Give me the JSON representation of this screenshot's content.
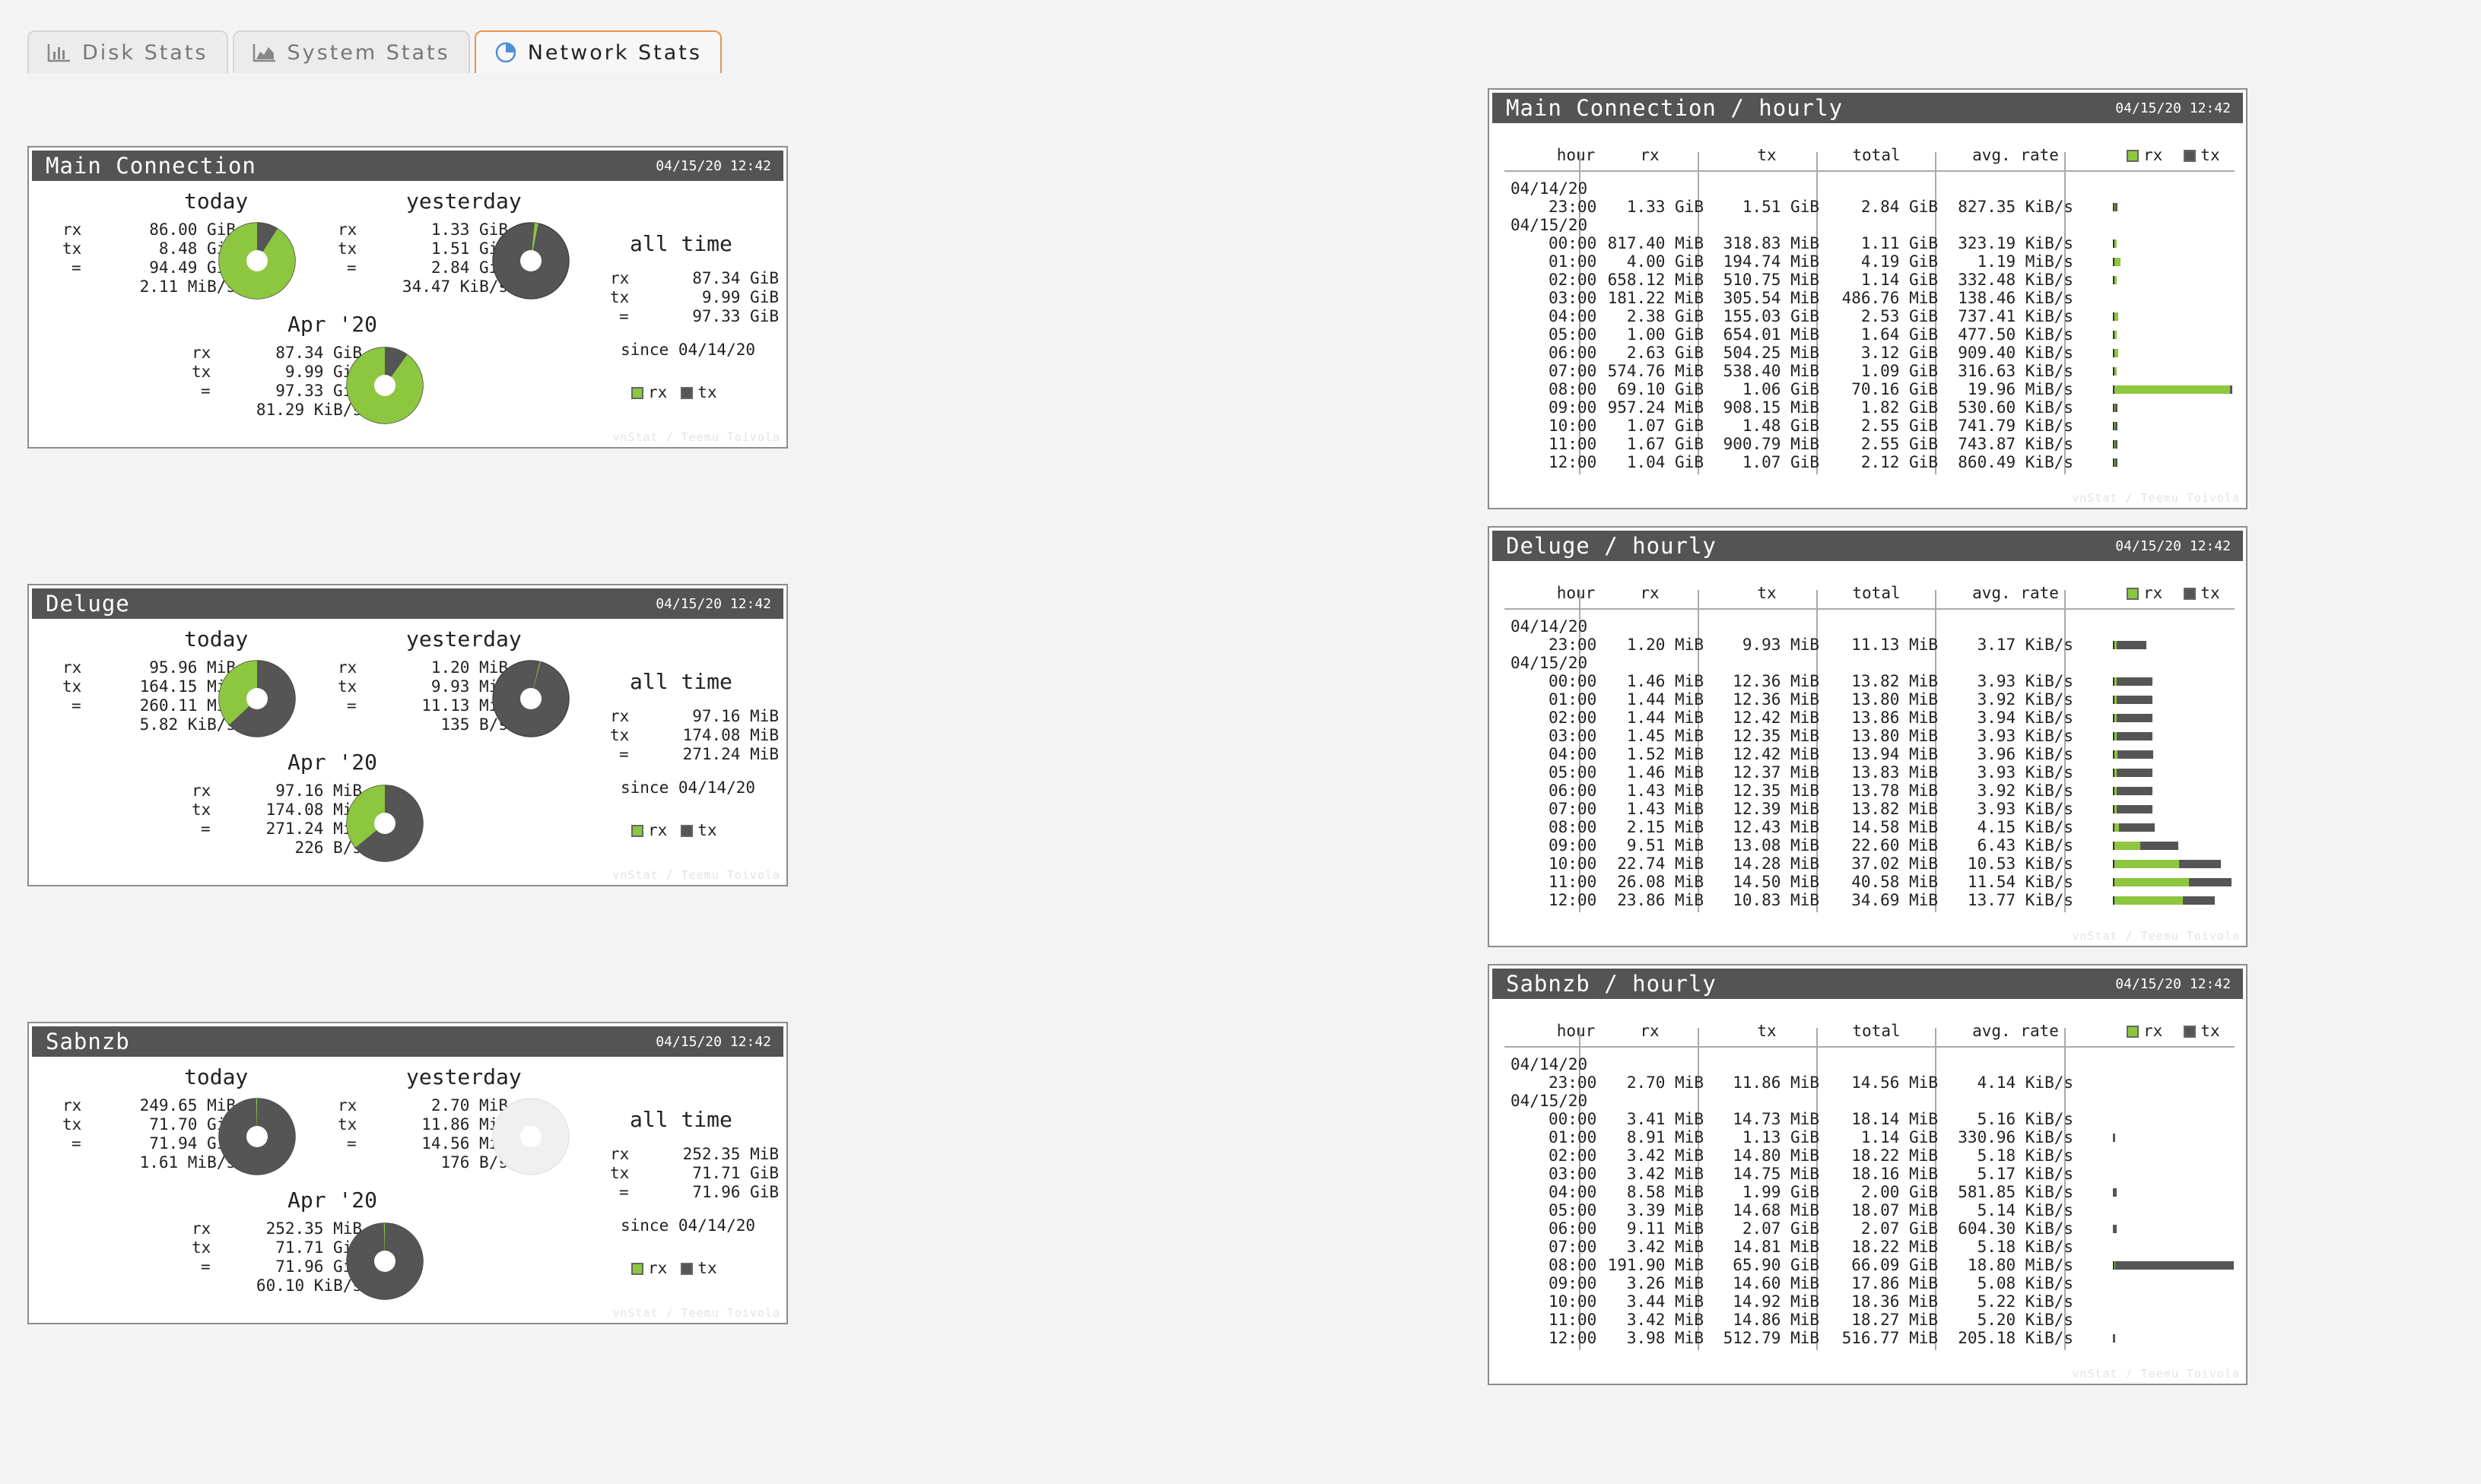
{
  "tabs": [
    {
      "label": "Disk Stats",
      "icon": "bar-chart-icon",
      "active": false
    },
    {
      "label": "System Stats",
      "icon": "area-chart-icon",
      "active": false
    },
    {
      "label": "Network Stats",
      "icon": "pie-chart-icon",
      "active": true
    }
  ],
  "colors": {
    "rx": "#8dc63f",
    "tx": "#555555",
    "accent": "#e8934f",
    "header": "#545454"
  },
  "summaries": [
    {
      "title": "Main Connection",
      "date": "04/15/20 12:42",
      "today": {
        "label": "today",
        "rx": "86.00 GiB",
        "tx": "8.48 GiB",
        "total": "94.49 GiB",
        "rate": "2.11 MiB/s",
        "rx_share": 0.91
      },
      "yesterday": {
        "label": "yesterday",
        "rx": "1.33 GiB",
        "tx": "1.51 GiB",
        "total": "2.84 GiB",
        "rate": "34.47 KiB/s",
        "rx_share": 0.015,
        "tx_share": 0.016
      },
      "month": {
        "label": "Apr '20",
        "rx": "87.34 GiB",
        "tx": "9.99 GiB",
        "total": "97.33 GiB",
        "rate": "81.29 KiB/s",
        "rx_share": 0.9
      },
      "alltime": {
        "label": "all time",
        "rx": "87.34 GiB",
        "tx": "9.99 GiB",
        "total": "97.33 GiB",
        "since": "since 04/14/20"
      }
    },
    {
      "title": "Deluge",
      "date": "04/15/20 12:42",
      "today": {
        "label": "today",
        "rx": "95.96 MiB",
        "tx": "164.15 MiB",
        "total": "260.11 MiB",
        "rate": "5.82 KiB/s",
        "rx_share": 0.37
      },
      "yesterday": {
        "label": "yesterday",
        "rx": "1.20 MiB",
        "tx": "9.93 MiB",
        "total": "11.13 MiB",
        "rate": "135 B/s",
        "rx_share": 0.004,
        "tx_share": 0.037
      },
      "month": {
        "label": "Apr '20",
        "rx": "97.16 MiB",
        "tx": "174.08 MiB",
        "total": "271.24 MiB",
        "rate": "226 B/s",
        "rx_share": 0.36
      },
      "alltime": {
        "label": "all time",
        "rx": "97.16 MiB",
        "tx": "174.08 MiB",
        "total": "271.24 MiB",
        "since": "since 04/14/20"
      }
    },
    {
      "title": "Sabnzb",
      "date": "04/15/20 12:42",
      "today": {
        "label": "today",
        "rx": "249.65 MiB",
        "tx": "71.70 GiB",
        "total": "71.94 GiB",
        "rate": "1.61 MiB/s",
        "rx_share": 0.004
      },
      "yesterday": {
        "label": "yesterday",
        "rx": "2.70 MiB",
        "tx": "11.86 MiB",
        "total": "14.56 MiB",
        "rate": "176 B/s",
        "rx_share": 0.0,
        "tx_share": 0.0
      },
      "month": {
        "label": "Apr '20",
        "rx": "252.35 MiB",
        "tx": "71.71 GiB",
        "total": "71.96 GiB",
        "rate": "60.10 KiB/s",
        "rx_share": 0.004
      },
      "alltime": {
        "label": "all time",
        "rx": "252.35 MiB",
        "tx": "71.71 GiB",
        "total": "71.96 GiB",
        "since": "since 04/14/20"
      }
    }
  ],
  "legend": {
    "rx": "rx",
    "tx": "tx"
  },
  "credit": "vnStat / Teemu Toivola",
  "columns": {
    "hour": "hour",
    "rx": "rx",
    "tx": "tx",
    "total": "total",
    "rate": "avg. rate"
  },
  "row_labels": {
    "rx": "rx",
    "tx": "tx",
    "total": "="
  },
  "hourly": [
    {
      "title": "Main Connection / hourly",
      "date": "04/15/20 12:42",
      "date_labels": [
        "04/14/20",
        "04/15/20"
      ],
      "rows": [
        [
          "23:00",
          "1.33 GiB",
          "1.51 GiB",
          "2.84 GiB",
          "827.35 KiB/s",
          0.008,
          0.008
        ],
        [
          "00:00",
          "817.40 MiB",
          "318.83 MiB",
          "1.11 GiB",
          "323.19 KiB/s",
          0.004,
          0.001
        ],
        [
          "01:00",
          "4.00 GiB",
          "194.74 MiB",
          "4.19 GiB",
          "1.19 MiB/s",
          0.05,
          0.002
        ],
        [
          "02:00",
          "658.12 MiB",
          "510.75 MiB",
          "1.14 GiB",
          "332.48 KiB/s",
          0.0035,
          0.003
        ],
        [
          "03:00",
          "181.22 MiB",
          "305.54 MiB",
          "486.76 MiB",
          "138.46 KiB/s",
          0.001,
          0.002
        ],
        [
          "04:00",
          "2.38 GiB",
          "155.03 GiB",
          "2.53 GiB",
          "737.41 KiB/s",
          0.03,
          0.002
        ],
        [
          "05:00",
          "1.00 GiB",
          "654.01 MiB",
          "1.64 GiB",
          "477.50 KiB/s",
          0.012,
          0.003
        ],
        [
          "06:00",
          "2.63 GiB",
          "504.25 MiB",
          "3.12 GiB",
          "909.40 KiB/s",
          0.03,
          0.003
        ],
        [
          "07:00",
          "574.76 MiB",
          "538.40 MiB",
          "1.09 GiB",
          "316.63 KiB/s",
          0.006,
          0.003
        ],
        [
          "08:00",
          "69.10 GiB",
          "1.06 GiB",
          "70.16 GiB",
          "19.96 MiB/s",
          0.985,
          0.015
        ],
        [
          "09:00",
          "957.24 MiB",
          "908.15 MiB",
          "1.82 GiB",
          "530.60 KiB/s",
          0.012,
          0.01
        ],
        [
          "10:00",
          "1.07 GiB",
          "1.48 GiB",
          "2.55 GiB",
          "741.79 KiB/s",
          0.013,
          0.017
        ],
        [
          "11:00",
          "1.67 GiB",
          "900.79 MiB",
          "2.55 GiB",
          "743.87 KiB/s",
          0.02,
          0.01
        ],
        [
          "12:00",
          "1.04 GiB",
          "1.07 GiB",
          "2.12 GiB",
          "860.49 KiB/s",
          0.013,
          0.013
        ]
      ]
    },
    {
      "title": "Deluge / hourly",
      "date": "04/15/20 12:42",
      "date_labels": [
        "04/14/20",
        "04/15/20"
      ],
      "rows": [
        [
          "23:00",
          "1.20 MiB",
          "9.93 MiB",
          "11.13 MiB",
          "3.17 KiB/s",
          0.03,
          0.25
        ],
        [
          "00:00",
          "1.46 MiB",
          "12.36 MiB",
          "13.82 MiB",
          "3.93 KiB/s",
          0.035,
          0.3
        ],
        [
          "01:00",
          "1.44 MiB",
          "12.36 MiB",
          "13.80 MiB",
          "3.92 KiB/s",
          0.035,
          0.3
        ],
        [
          "02:00",
          "1.44 MiB",
          "12.42 MiB",
          "13.86 MiB",
          "3.94 KiB/s",
          0.035,
          0.3
        ],
        [
          "03:00",
          "1.45 MiB",
          "12.35 MiB",
          "13.80 MiB",
          "3.93 KiB/s",
          0.035,
          0.3
        ],
        [
          "04:00",
          "1.52 MiB",
          "12.42 MiB",
          "13.94 MiB",
          "3.96 KiB/s",
          0.037,
          0.3
        ],
        [
          "05:00",
          "1.46 MiB",
          "12.37 MiB",
          "13.83 MiB",
          "3.93 KiB/s",
          0.035,
          0.3
        ],
        [
          "06:00",
          "1.43 MiB",
          "12.35 MiB",
          "13.78 MiB",
          "3.92 KiB/s",
          0.035,
          0.3
        ],
        [
          "07:00",
          "1.43 MiB",
          "12.39 MiB",
          "13.82 MiB",
          "3.93 KiB/s",
          0.035,
          0.3
        ],
        [
          "08:00",
          "2.15 MiB",
          "12.43 MiB",
          "14.58 MiB",
          "4.15 KiB/s",
          0.05,
          0.3
        ],
        [
          "09:00",
          "9.51 MiB",
          "13.08 MiB",
          "22.60 MiB",
          "6.43 KiB/s",
          0.23,
          0.32
        ],
        [
          "10:00",
          "22.74 MiB",
          "14.28 MiB",
          "37.02 MiB",
          "10.53 KiB/s",
          0.56,
          0.35
        ],
        [
          "11:00",
          "26.08 MiB",
          "14.50 MiB",
          "40.58 MiB",
          "11.54 KiB/s",
          0.64,
          0.36
        ],
        [
          "12:00",
          "23.86 MiB",
          "10.83 MiB",
          "34.69 MiB",
          "13.77 KiB/s",
          0.59,
          0.27
        ]
      ]
    },
    {
      "title": "Sabnzb / hourly",
      "date": "04/15/20 12:42",
      "date_labels": [
        "04/14/20",
        "04/15/20"
      ],
      "rows": [
        [
          "23:00",
          "2.70 MiB",
          "11.86 MiB",
          "14.56 MiB",
          "4.14 KiB/s",
          0.0,
          0.0
        ],
        [
          "00:00",
          "3.41 MiB",
          "14.73 MiB",
          "18.14 MiB",
          "5.16 KiB/s",
          0.0,
          0.0
        ],
        [
          "01:00",
          "8.91 MiB",
          "1.13 GiB",
          "1.14 GiB",
          "330.96 KiB/s",
          0.0,
          0.017
        ],
        [
          "02:00",
          "3.42 MiB",
          "14.80 MiB",
          "18.22 MiB",
          "5.18 KiB/s",
          0.0,
          0.0
        ],
        [
          "03:00",
          "3.42 MiB",
          "14.75 MiB",
          "18.16 MiB",
          "5.17 KiB/s",
          0.0,
          0.0
        ],
        [
          "04:00",
          "8.58 MiB",
          "1.99 GiB",
          "2.00 GiB",
          "581.85 KiB/s",
          0.0,
          0.03
        ],
        [
          "05:00",
          "3.39 MiB",
          "14.68 MiB",
          "18.07 MiB",
          "5.14 KiB/s",
          0.0,
          0.0
        ],
        [
          "06:00",
          "9.11 MiB",
          "2.07 GiB",
          "2.07 GiB",
          "604.30 KiB/s",
          0.0,
          0.031
        ],
        [
          "07:00",
          "3.42 MiB",
          "14.81 MiB",
          "18.22 MiB",
          "5.18 KiB/s",
          0.0,
          0.0
        ],
        [
          "08:00",
          "191.90 MiB",
          "65.90 GiB",
          "66.09 GiB",
          "18.80 MiB/s",
          0.003,
          0.997
        ],
        [
          "09:00",
          "3.26 MiB",
          "14.60 MiB",
          "17.86 MiB",
          "5.08 KiB/s",
          0.0,
          0.0
        ],
        [
          "10:00",
          "3.44 MiB",
          "14.92 MiB",
          "18.36 MiB",
          "5.22 KiB/s",
          0.0,
          0.0
        ],
        [
          "11:00",
          "3.42 MiB",
          "14.86 MiB",
          "18.27 MiB",
          "5.20 KiB/s",
          0.0,
          0.0
        ],
        [
          "12:00",
          "3.98 MiB",
          "512.79 MiB",
          "516.77 MiB",
          "205.18 KiB/s",
          0.0,
          0.008
        ]
      ]
    }
  ]
}
